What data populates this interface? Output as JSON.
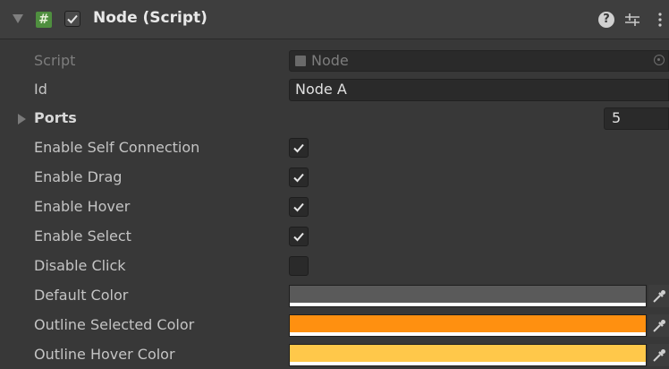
{
  "header": {
    "title": "Node (Script)",
    "script_icon_glyph": "#",
    "help_glyph": "?",
    "enabled": true
  },
  "fields": {
    "script": {
      "label": "Script",
      "value": "Node"
    },
    "id": {
      "label": "Id",
      "value": "Node A"
    },
    "ports": {
      "label": "Ports",
      "value": "5"
    },
    "enable_self_connection": {
      "label": "Enable Self Connection",
      "checked": true
    },
    "enable_drag": {
      "label": "Enable Drag",
      "checked": true
    },
    "enable_hover": {
      "label": "Enable Hover",
      "checked": true
    },
    "enable_select": {
      "label": "Enable Select",
      "checked": true
    },
    "disable_click": {
      "label": "Disable Click",
      "checked": false
    },
    "default_color": {
      "label": "Default Color",
      "color": "#5a5a5a"
    },
    "outline_selected_color": {
      "label": "Outline Selected Color",
      "color": "#ff9010"
    },
    "outline_hover_color": {
      "label": "Outline Hover Color",
      "color": "#ffc84a"
    }
  },
  "colors": {
    "background": "#383838",
    "header_bg": "#3e3e3e",
    "field_bg": "#2a2a2a",
    "text": "#c4c4c4",
    "dim_text": "#7d7d7d"
  },
  "icons": [
    "foldout-arrow-icon",
    "script-icon",
    "checkmark-icon",
    "help-icon",
    "preset-icon",
    "kebab-menu-icon",
    "object-picker-icon",
    "eyedropper-icon"
  ]
}
